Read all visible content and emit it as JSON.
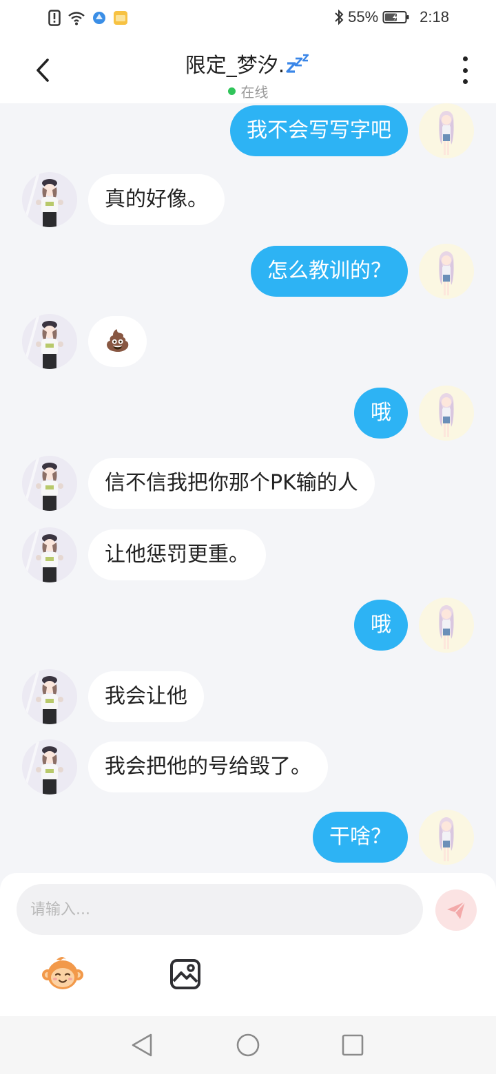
{
  "status_bar": {
    "battery": "55%",
    "time": "2:18"
  },
  "header": {
    "title": "限定_梦汐.",
    "status": "在线"
  },
  "messages": [
    {
      "side": "right",
      "text": "我不会写写字吧"
    },
    {
      "side": "left",
      "text": "真的好像。"
    },
    {
      "side": "right",
      "text": "怎么教训的？"
    },
    {
      "side": "left",
      "text": "💩"
    },
    {
      "side": "right",
      "text": "哦"
    },
    {
      "side": "left",
      "text": "信不信我把你那个PK输的人"
    },
    {
      "side": "left",
      "text": "让他惩罚更重。"
    },
    {
      "side": "right",
      "text": "哦"
    },
    {
      "side": "left",
      "text": "我会让他"
    },
    {
      "side": "left",
      "text": "我会把他的号给毁了。"
    },
    {
      "side": "right",
      "text": "干啥？"
    }
  ],
  "input": {
    "placeholder": "请输入..."
  },
  "icons": {
    "back": "back-arrow-icon",
    "more": "more-vertical-icon",
    "send": "send-icon",
    "emoji": "emoji-monkey-icon",
    "image": "image-icon",
    "sleep": "zzz-icon"
  },
  "colors": {
    "bubble_self": "#2db3f4",
    "bubble_other": "#ffffff",
    "online": "#30c45a",
    "chat_background": "#f4f5f8"
  }
}
